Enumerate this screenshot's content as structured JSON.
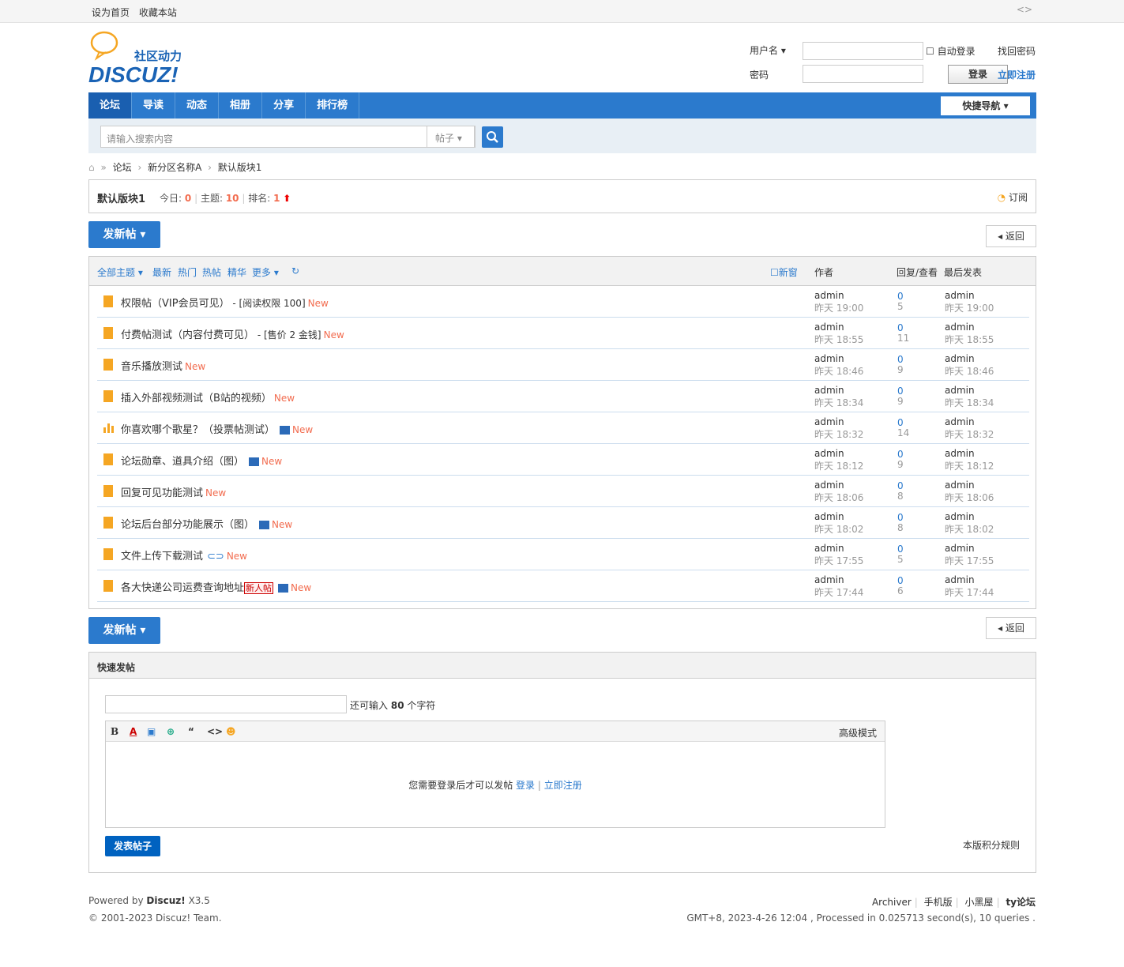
{
  "topbar": {
    "set_home": "设为首页",
    "bookmark": "收藏本站",
    "toggle": "<>"
  },
  "logo": {
    "cn": "社区动力",
    "en": "DISCUZ!"
  },
  "login": {
    "username_label": "用户名",
    "password_label": "密码",
    "auto_login": "自动登录",
    "login_button": "登录",
    "find_password": "找回密码",
    "register": "立即注册"
  },
  "nav": {
    "items": [
      "论坛",
      "导读",
      "动态",
      "相册",
      "分享",
      "排行榜"
    ],
    "quick_nav": "快捷导航"
  },
  "search": {
    "placeholder": "请输入搜索内容",
    "type": "帖子"
  },
  "breadcrumb": [
    "论坛",
    "新分区名称A",
    "默认版块1"
  ],
  "forum": {
    "name": "默认版块1",
    "today_label": "今日:",
    "today": "0",
    "threads_label": "主题:",
    "threads": "10",
    "rank_label": "排名:",
    "rank": "1",
    "subscribe": "订阅"
  },
  "buttons": {
    "new_post": "发新帖",
    "back": "返回"
  },
  "filters": {
    "all": "全部主题",
    "latest": "最新",
    "hot": "热门",
    "hot_posts": "热帖",
    "digest": "精华",
    "more": "更多",
    "new_window": "新窗",
    "author": "作者",
    "replies_views": "回复/查看",
    "last_post": "最后发表"
  },
  "threads": [
    {
      "title": "权限帖（VIP会员可见）",
      "extra": " - [阅读权限 100]",
      "new": "New",
      "author": "admin",
      "time": "昨天 19:00",
      "replies": "0",
      "views": "5",
      "last_user": "admin",
      "last_time": "昨天 19:00"
    },
    {
      "title": "付费帖测试（内容付费可见）",
      "extra": " - [售价 2 金钱]",
      "new": "New",
      "author": "admin",
      "time": "昨天 18:55",
      "replies": "0",
      "views": "11",
      "last_user": "admin",
      "last_time": "昨天 18:55"
    },
    {
      "title": "音乐播放测试",
      "extra": "",
      "new": "New",
      "author": "admin",
      "time": "昨天 18:46",
      "replies": "0",
      "views": "9",
      "last_user": "admin",
      "last_time": "昨天 18:46"
    },
    {
      "title": "插入外部视频测试（B站的视频）",
      "extra": "",
      "new": "New",
      "author": "admin",
      "time": "昨天 18:34",
      "replies": "0",
      "views": "9",
      "last_user": "admin",
      "last_time": "昨天 18:34"
    },
    {
      "title": "你喜欢哪个歌星？（投票帖测试）",
      "extra": "",
      "new": "New",
      "author": "admin",
      "time": "昨天 18:32",
      "replies": "0",
      "views": "14",
      "last_user": "admin",
      "last_time": "昨天 18:32"
    },
    {
      "title": "论坛勋章、道具介绍（图）",
      "extra": "",
      "new": "New",
      "author": "admin",
      "time": "昨天 18:12",
      "replies": "0",
      "views": "9",
      "last_user": "admin",
      "last_time": "昨天 18:12"
    },
    {
      "title": "回复可见功能测试",
      "extra": "",
      "new": "New",
      "author": "admin",
      "time": "昨天 18:06",
      "replies": "0",
      "views": "8",
      "last_user": "admin",
      "last_time": "昨天 18:06"
    },
    {
      "title": "论坛后台部分功能展示（图）",
      "extra": "",
      "new": "New",
      "author": "admin",
      "time": "昨天 18:02",
      "replies": "0",
      "views": "8",
      "last_user": "admin",
      "last_time": "昨天 18:02"
    },
    {
      "title": "文件上传下载测试",
      "extra": "",
      "new": "New",
      "author": "admin",
      "time": "昨天 17:55",
      "replies": "0",
      "views": "5",
      "last_user": "admin",
      "last_time": "昨天 17:55"
    },
    {
      "title": "各大快递公司运费查询地址",
      "extra": "",
      "badge": "新人帖",
      "new": "New",
      "author": "admin",
      "time": "昨天 17:44",
      "replies": "0",
      "views": "6",
      "last_user": "admin",
      "last_time": "昨天 17:44"
    }
  ],
  "fastpost": {
    "title": "快速发帖",
    "remain_prefix": "还可输入",
    "remain_count": "80",
    "remain_suffix": "个字符",
    "advanced": "高级模式",
    "need_login": "您需要登录后才可以发帖",
    "login": "登录",
    "register": "立即注册",
    "submit": "发表帖子",
    "rules": "本版积分规则"
  },
  "footer": {
    "powered_by": "Powered by",
    "brand": "Discuz!",
    "version": "X3.5",
    "copyright": "© 2001-2023 Discuz! Team.",
    "links": [
      "Archiver",
      "手机版",
      "小黑屋",
      "ty论坛"
    ],
    "stats": "GMT+8, 2023-4-26 12:04 , Processed in 0.025713 second(s), 10 queries ."
  },
  "colors": {
    "nav_blue": "#2b7acd",
    "new_red": "#f26c4f",
    "file_orange": "#f5a623"
  }
}
